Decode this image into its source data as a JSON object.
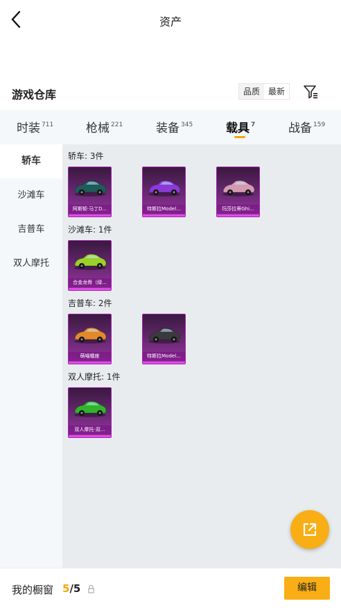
{
  "header": {
    "title": "资产",
    "back_icon": "chevron-left-icon"
  },
  "section": {
    "title": "游戏仓库",
    "sort_options": [
      "品质",
      "最新"
    ],
    "active_sort": "最新",
    "filter_icon": "filter-list-icon"
  },
  "tabs": [
    {
      "label": "时装",
      "count": "711"
    },
    {
      "label": "枪械",
      "count": "221"
    },
    {
      "label": "装备",
      "count": "345"
    },
    {
      "label": "载具",
      "count": "7",
      "active": true
    },
    {
      "label": "战备",
      "count": "159"
    }
  ],
  "sidebar": {
    "items": [
      {
        "label": "轿车",
        "active": true
      },
      {
        "label": "沙滩车"
      },
      {
        "label": "吉普车"
      },
      {
        "label": "双人摩托"
      }
    ]
  },
  "groups": [
    {
      "title": "轿车: 3件",
      "items": [
        {
          "name": "阿斯顿·马丁D...",
          "car_color": "#1e5b5b"
        },
        {
          "name": "特斯拉Model...",
          "car_color": "#8a3ad6"
        },
        {
          "name": "玛莎拉蒂Ghi...",
          "car_color": "#d49ab0"
        }
      ]
    },
    {
      "title": "沙滩车: 1件",
      "items": [
        {
          "name": "合金龙骨（绿...",
          "car_color": "#9bd12a"
        }
      ]
    },
    {
      "title": "吉普车: 2件",
      "items": [
        {
          "name": "萌喵橘座",
          "car_color": "#e08a2a"
        },
        {
          "name": "特斯拉Model...",
          "car_color": "#3a3a3e"
        }
      ]
    },
    {
      "title": "双人摩托: 1件",
      "items": [
        {
          "name": "双人摩托-双...",
          "car_color": "#2fb52a"
        }
      ]
    }
  ],
  "fab": {
    "icon": "external-link-icon"
  },
  "bottom": {
    "label": "我的橱窗",
    "current": "5",
    "separator": "/",
    "total": "5",
    "lock_icon": "lock-icon",
    "edit_label": "编辑"
  },
  "colors": {
    "accent": "#f8ae14",
    "card_border": "#a322ad",
    "sidebar_bg": "#f4f8fb",
    "content_bg": "#e9ecef"
  }
}
